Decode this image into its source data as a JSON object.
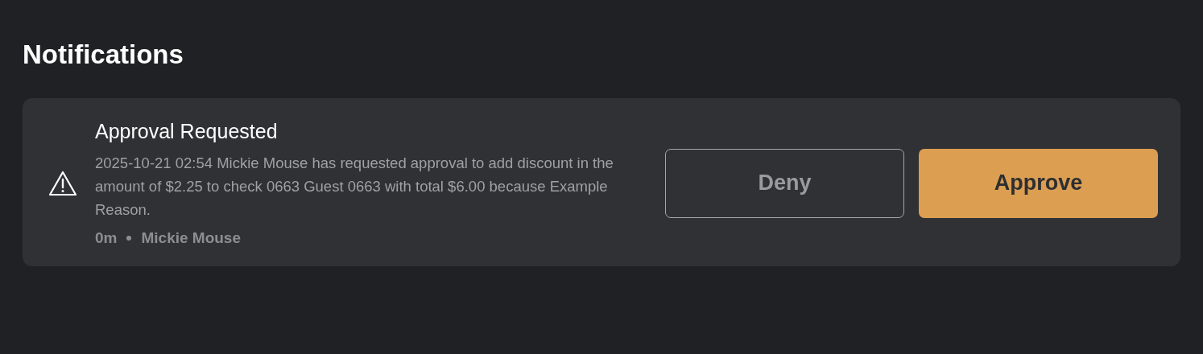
{
  "page": {
    "title": "Notifications"
  },
  "notifications": [
    {
      "kind": "warning",
      "title": "Approval Requested",
      "message": "2025-10-21 02:54 Mickie Mouse has requested approval to add discount in the amount of $2.25 to check 0663 Guest 0663 with total $6.00 because Example Reason.",
      "time": "0m",
      "author": "Mickie Mouse",
      "buttons": [
        {
          "label": "Deny",
          "kind": "secondary"
        },
        {
          "label": "Approve",
          "kind": "primary"
        }
      ]
    }
  ]
}
